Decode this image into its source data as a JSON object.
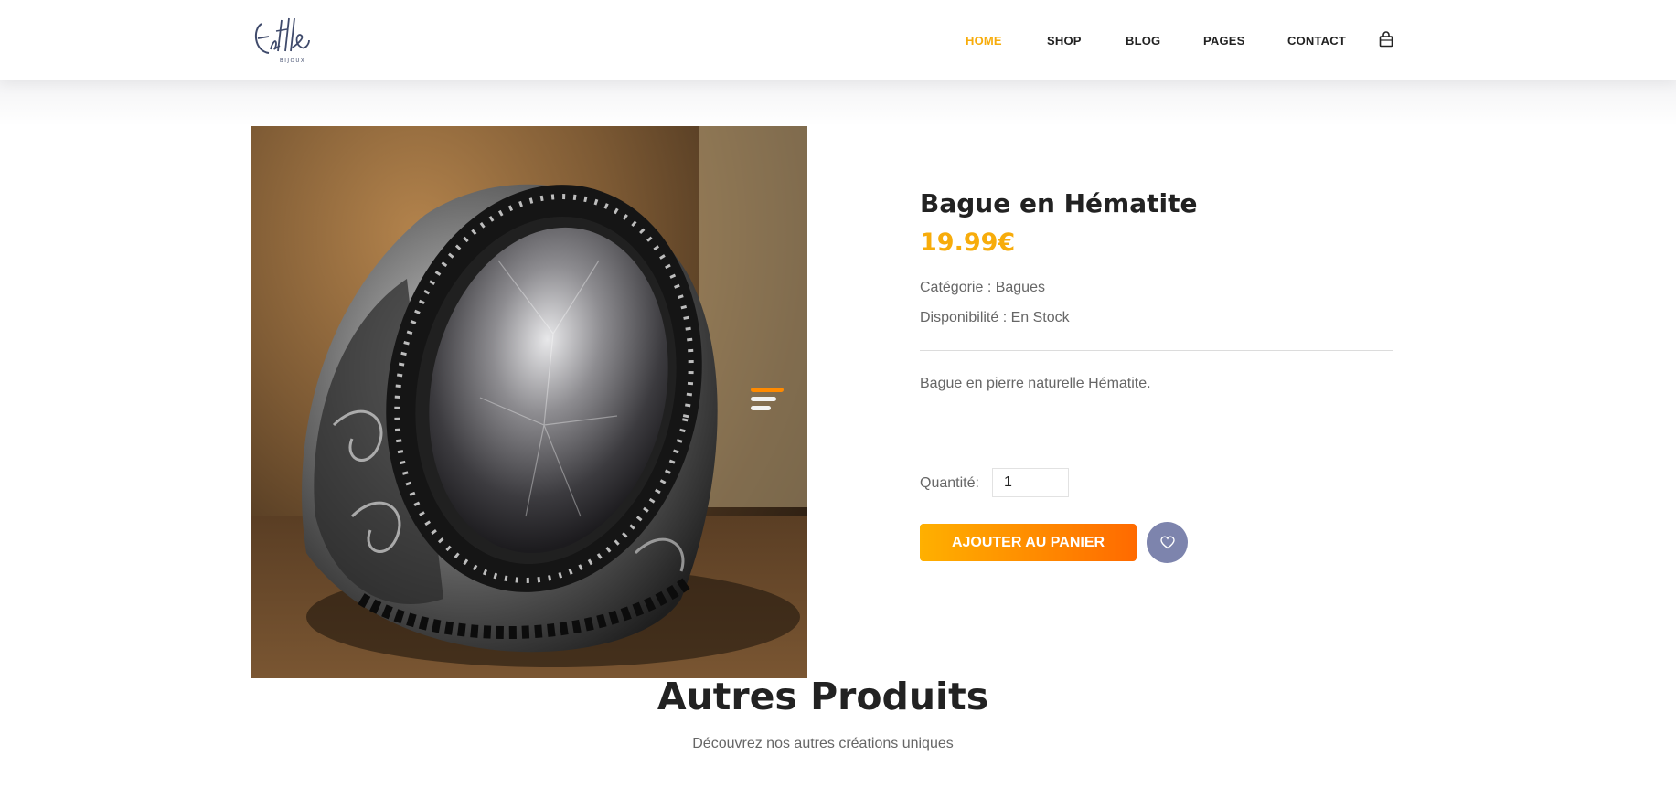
{
  "brand": {
    "logo_text": "Estelle",
    "logo_sub": "BIJOUX"
  },
  "nav": {
    "items": [
      {
        "label": "HOME",
        "active": true
      },
      {
        "label": "SHOP",
        "active": false
      },
      {
        "label": "BLOG",
        "active": false
      },
      {
        "label": "PAGES",
        "active": false
      },
      {
        "label": "CONTACT",
        "active": false
      }
    ],
    "cart_icon": "shopping-bag-icon"
  },
  "product": {
    "image_icon": "ring-photo",
    "title": "Bague en Hématite",
    "price": "19.99€",
    "category": "Catégorie : Bagues",
    "availability": "Disponibilité : En Stock",
    "description": "Bague en pierre naturelle Hématite.",
    "quantity_label": "Quantité:",
    "quantity_value": "1",
    "add_to_cart_label": "AJOUTER AU PANIER",
    "wishlist_icon": "heart-icon"
  },
  "section": {
    "title": "Autres Produits",
    "subtitle": "Découvrez nos autres créations uniques"
  },
  "colors": {
    "accent": "#f7ac0b",
    "button_start": "#ffb000",
    "button_end": "#ff6a00",
    "wishlist_bg": "#7d84ad",
    "menu_top_bar": "#ff8a00",
    "menu_bars": "#f2f2f2"
  }
}
